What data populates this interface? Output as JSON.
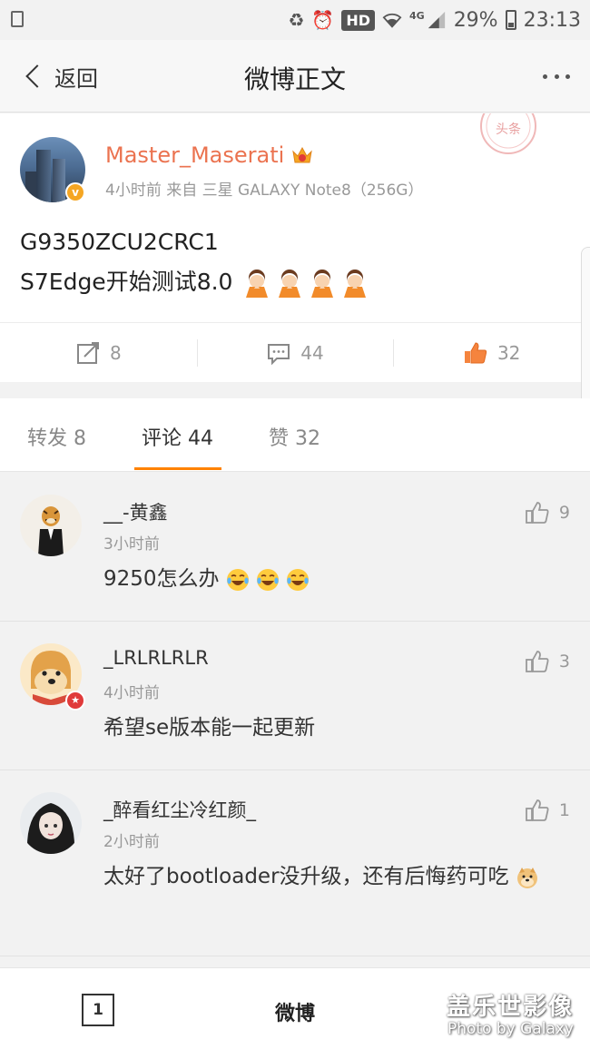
{
  "status_bar": {
    "network": "4G",
    "hd": "HD",
    "battery": "29%",
    "time": "23:13"
  },
  "nav": {
    "back_label": "返回",
    "title": "微博正文"
  },
  "post": {
    "username": "Master_Maserati",
    "meta": "4小时前 来自 三星 GALAXY Note8（256G）",
    "stamp_text": "头条",
    "text_line1": "G9350ZCU2CRC1",
    "text_line2": "S7Edge开始测试8.0",
    "verified_badge": "v"
  },
  "actions": {
    "repost_count": "8",
    "comment_count": "44",
    "like_count": "32"
  },
  "tabs": [
    {
      "label": "转发 8"
    },
    {
      "label": "评论 44"
    },
    {
      "label": "赞 32"
    }
  ],
  "comments": [
    {
      "name": "__-黄鑫",
      "time": "3小时前",
      "text": "9250怎么办",
      "likes": "9"
    },
    {
      "name": "_LRLRLRLR",
      "time": "4小时前",
      "text": "希望se版本能一起更新",
      "likes": "3"
    },
    {
      "name": "_醉看红尘冷红颜_",
      "time": "2小时前",
      "text": "太好了bootloader没升级，还有后悔药可吃",
      "likes": "1"
    }
  ],
  "bottom_bar": {
    "page_number": "1",
    "weibo_label": "微博"
  },
  "watermark": {
    "line1": "盖乐世影像",
    "line2": "Photo by Galaxy"
  },
  "colors": {
    "username_orange": "#eb7350",
    "tab_indicator": "#ff8200",
    "like_active": "#f5843e"
  }
}
